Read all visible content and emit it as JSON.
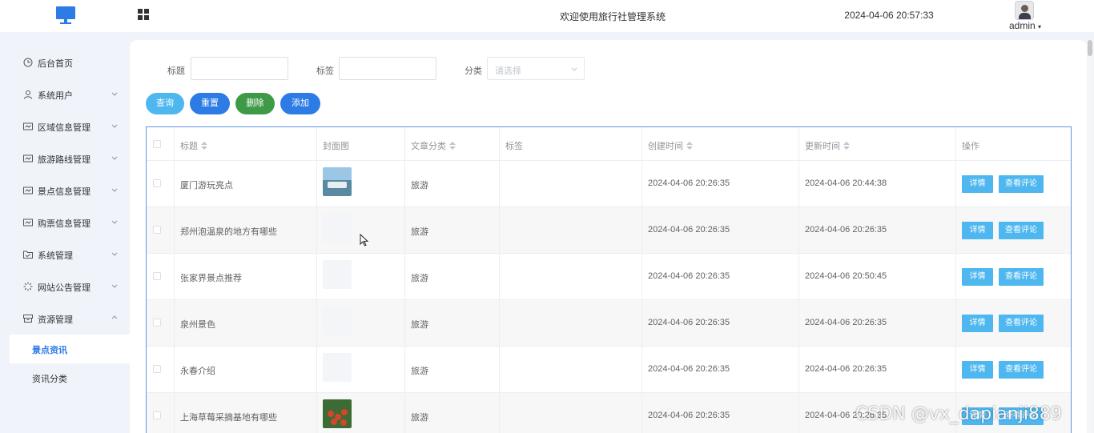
{
  "header": {
    "title": "欢迎使用旅行社管理系统",
    "datetime": "2024-04-06 20:57:33",
    "user": "admin"
  },
  "sidebar": {
    "items": [
      {
        "label": "后台首页",
        "icon": "clock-icon",
        "has_arrow": false
      },
      {
        "label": "系统用户",
        "icon": "user-icon",
        "has_arrow": true
      },
      {
        "label": "区域信息管理",
        "icon": "card-icon",
        "has_arrow": true
      },
      {
        "label": "旅游路线管理",
        "icon": "card-icon",
        "has_arrow": true
      },
      {
        "label": "景点信息管理",
        "icon": "card-icon",
        "has_arrow": true
      },
      {
        "label": "购票信息管理",
        "icon": "card-icon",
        "has_arrow": true
      },
      {
        "label": "系统管理",
        "icon": "folder-icon",
        "has_arrow": true
      },
      {
        "label": "网站公告管理",
        "icon": "loading-icon",
        "has_arrow": true
      },
      {
        "label": "资源管理",
        "icon": "box-icon",
        "has_arrow": true,
        "expanded": true
      }
    ],
    "subitems": [
      {
        "label": "景点资讯",
        "active": true
      },
      {
        "label": "资讯分类",
        "active": false
      }
    ]
  },
  "search": {
    "title_label": "标题",
    "title_value": "",
    "tag_label": "标签",
    "tag_value": "",
    "category_label": "分类",
    "category_placeholder": "请选择"
  },
  "buttons": {
    "query": "查询",
    "reset": "重置",
    "delete": "删除",
    "add": "添加"
  },
  "table": {
    "columns": [
      "标题",
      "封面图",
      "文章分类",
      "标签",
      "创建时间",
      "更新时间",
      "操作"
    ],
    "rows": [
      {
        "title": "厦门游玩亮点",
        "cover": "harbor",
        "category": "旅游",
        "tag": "",
        "created": "2024-04-06 20:26:35",
        "updated": "2024-04-06 20:44:38"
      },
      {
        "title": "郑州泡温泉的地方有哪些",
        "cover": "none",
        "category": "旅游",
        "tag": "",
        "created": "2024-04-06 20:26:35",
        "updated": "2024-04-06 20:26:35"
      },
      {
        "title": "张家界景点推荐",
        "cover": "none",
        "category": "旅游",
        "tag": "",
        "created": "2024-04-06 20:26:35",
        "updated": "2024-04-06 20:50:45"
      },
      {
        "title": "泉州景色",
        "cover": "none",
        "category": "旅游",
        "tag": "",
        "created": "2024-04-06 20:26:35",
        "updated": "2024-04-06 20:26:35"
      },
      {
        "title": "永春介绍",
        "cover": "none",
        "category": "旅游",
        "tag": "",
        "created": "2024-04-06 20:26:35",
        "updated": "2024-04-06 20:26:35"
      },
      {
        "title": "上海草莓采摘基地有哪些",
        "cover": "strawberry",
        "category": "旅游",
        "tag": "",
        "created": "2024-04-06 20:26:35",
        "updated": "2024-04-06 20:26:35"
      }
    ],
    "action_detail": "详情",
    "action_comments": "查看评论"
  },
  "watermark": "CSDN @vx_dapianji889",
  "colors": {
    "primary": "#2d7be5",
    "info": "#4fb7ef",
    "danger_green": "#3f9a47",
    "table_border": "#5f94e6"
  }
}
